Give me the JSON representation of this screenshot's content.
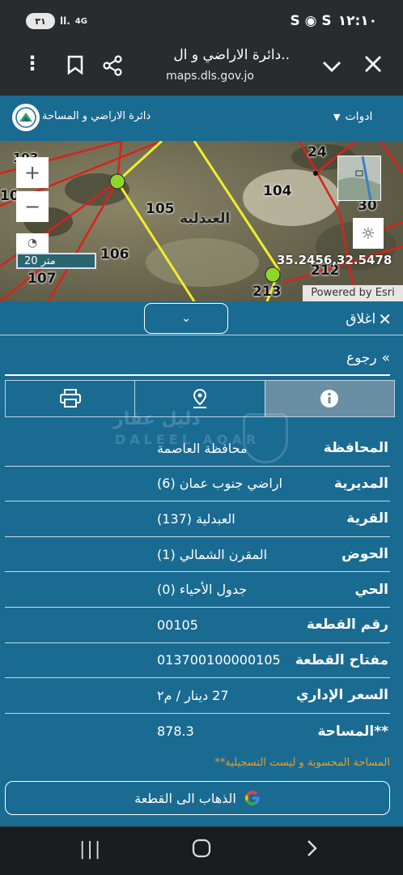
{
  "status": {
    "time": "١٢:١٠",
    "battery_pill": "٣١",
    "network": "4G",
    "notif_icons": "S ◉ S"
  },
  "browser": {
    "title": "دائرة الاراضي و ال..",
    "host": "maps.dls.gov.jo"
  },
  "site": {
    "dept_name": "دائرة الاراضي و المساحة",
    "tools_label": "ادوات"
  },
  "map": {
    "coords": "35.2456,32.5478",
    "scale": "20 متر",
    "powered": "Powered by Esri",
    "village_label": "العبدلية",
    "parcels": [
      "105",
      "106",
      "104",
      "24",
      "212",
      "213",
      "107",
      "10",
      "30",
      "193"
    ],
    "colors": {
      "parcel_line": "#d9211c",
      "selected_line": "#f2ee2a",
      "marker": "#8fd62a"
    }
  },
  "panel": {
    "close_label": "اغلاق",
    "back_label": "رجوع",
    "tabs": [
      {
        "name": "info",
        "icon": "info-icon"
      },
      {
        "name": "location",
        "icon": "location-pin-icon"
      },
      {
        "name": "print",
        "icon": "printer-icon"
      }
    ],
    "watermark_ar": "دليل عقار",
    "watermark_en": "DALEEL AQAR",
    "rows": [
      {
        "label": "المحافظة",
        "value": "محافظة العاصمة"
      },
      {
        "label": "المديرية",
        "value": "اراضي جنوب عمان (6)"
      },
      {
        "label": "القرية",
        "value": "العبدلية (137)"
      },
      {
        "label": "الحوض",
        "value": "المقرن الشمالي (1)"
      },
      {
        "label": "الحي",
        "value": "جدول الأحياء (0)"
      },
      {
        "label": "رقم القطعة",
        "value": "00105"
      },
      {
        "label": "مفتاح القطعة",
        "value": "013700100000105"
      },
      {
        "label": "السعر الإداري",
        "value": "27 دينار / م٢"
      },
      {
        "label": "**المساحة",
        "value": "878.3"
      }
    ],
    "note": "**المساحة المحسوبة و ليست التسجيلية",
    "goto_label": "الذهاب الى القطعة",
    "colors": {
      "panel_bg": "#1a6b92",
      "active_tab": "#6a8ea3",
      "note": "#e6a02e"
    }
  }
}
